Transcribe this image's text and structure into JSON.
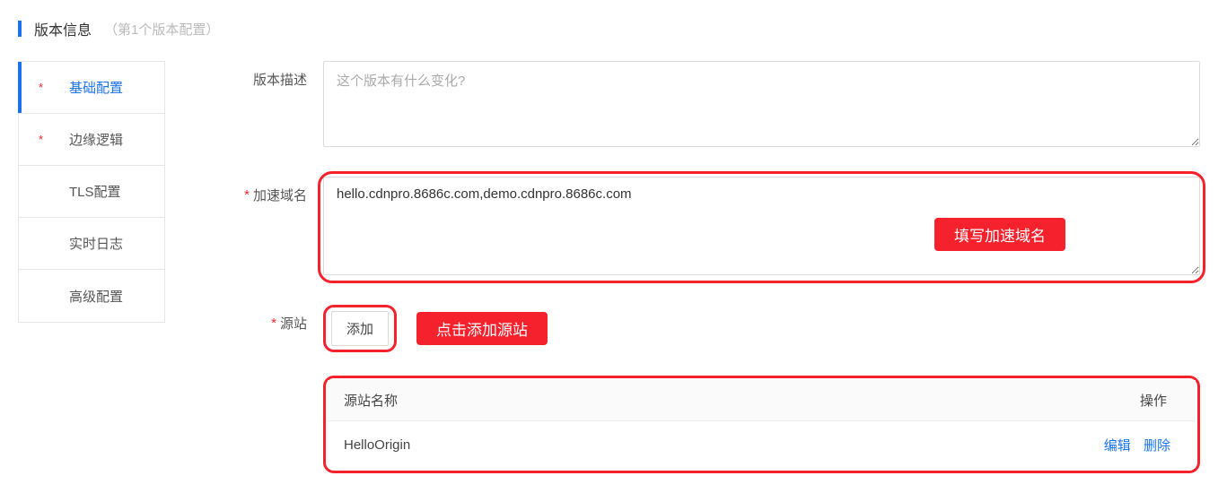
{
  "header": {
    "title": "版本信息",
    "subtitle": "（第1个版本配置）"
  },
  "sidebar": {
    "items": [
      {
        "label": "基础配置",
        "required": true,
        "active": true
      },
      {
        "label": "边缘逻辑",
        "required": true,
        "active": false
      },
      {
        "label": "TLS配置",
        "required": false,
        "active": false
      },
      {
        "label": "实时日志",
        "required": false,
        "active": false
      },
      {
        "label": "高级配置",
        "required": false,
        "active": false
      }
    ]
  },
  "form": {
    "description": {
      "label": "版本描述",
      "placeholder": "这个版本有什么变化?",
      "value": ""
    },
    "domains": {
      "label": "加速域名",
      "value": "hello.cdnpro.8686c.com,demo.cdnpro.8686c.com",
      "callout": "填写加速域名"
    },
    "origin": {
      "label": "源站",
      "add_button": "添加",
      "callout": "点击添加源站",
      "table": {
        "col_name": "源站名称",
        "col_actions": "操作",
        "rows": [
          {
            "name": "HelloOrigin",
            "edit": "编辑",
            "delete": "删除"
          }
        ]
      }
    }
  }
}
